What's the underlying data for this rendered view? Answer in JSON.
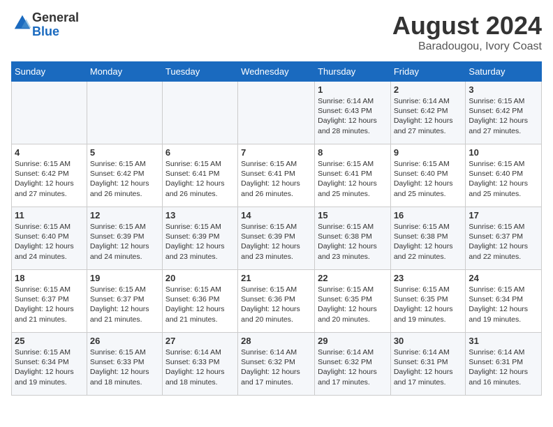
{
  "header": {
    "logo_line1": "General",
    "logo_line2": "Blue",
    "month": "August 2024",
    "location": "Baradougou, Ivory Coast"
  },
  "days_of_week": [
    "Sunday",
    "Monday",
    "Tuesday",
    "Wednesday",
    "Thursday",
    "Friday",
    "Saturday"
  ],
  "weeks": [
    [
      {
        "day": "",
        "info": ""
      },
      {
        "day": "",
        "info": ""
      },
      {
        "day": "",
        "info": ""
      },
      {
        "day": "",
        "info": ""
      },
      {
        "day": "1",
        "info": "Sunrise: 6:14 AM\nSunset: 6:43 PM\nDaylight: 12 hours\nand 28 minutes."
      },
      {
        "day": "2",
        "info": "Sunrise: 6:14 AM\nSunset: 6:42 PM\nDaylight: 12 hours\nand 27 minutes."
      },
      {
        "day": "3",
        "info": "Sunrise: 6:15 AM\nSunset: 6:42 PM\nDaylight: 12 hours\nand 27 minutes."
      }
    ],
    [
      {
        "day": "4",
        "info": "Sunrise: 6:15 AM\nSunset: 6:42 PM\nDaylight: 12 hours\nand 27 minutes."
      },
      {
        "day": "5",
        "info": "Sunrise: 6:15 AM\nSunset: 6:42 PM\nDaylight: 12 hours\nand 26 minutes."
      },
      {
        "day": "6",
        "info": "Sunrise: 6:15 AM\nSunset: 6:41 PM\nDaylight: 12 hours\nand 26 minutes."
      },
      {
        "day": "7",
        "info": "Sunrise: 6:15 AM\nSunset: 6:41 PM\nDaylight: 12 hours\nand 26 minutes."
      },
      {
        "day": "8",
        "info": "Sunrise: 6:15 AM\nSunset: 6:41 PM\nDaylight: 12 hours\nand 25 minutes."
      },
      {
        "day": "9",
        "info": "Sunrise: 6:15 AM\nSunset: 6:40 PM\nDaylight: 12 hours\nand 25 minutes."
      },
      {
        "day": "10",
        "info": "Sunrise: 6:15 AM\nSunset: 6:40 PM\nDaylight: 12 hours\nand 25 minutes."
      }
    ],
    [
      {
        "day": "11",
        "info": "Sunrise: 6:15 AM\nSunset: 6:40 PM\nDaylight: 12 hours\nand 24 minutes."
      },
      {
        "day": "12",
        "info": "Sunrise: 6:15 AM\nSunset: 6:39 PM\nDaylight: 12 hours\nand 24 minutes."
      },
      {
        "day": "13",
        "info": "Sunrise: 6:15 AM\nSunset: 6:39 PM\nDaylight: 12 hours\nand 23 minutes."
      },
      {
        "day": "14",
        "info": "Sunrise: 6:15 AM\nSunset: 6:39 PM\nDaylight: 12 hours\nand 23 minutes."
      },
      {
        "day": "15",
        "info": "Sunrise: 6:15 AM\nSunset: 6:38 PM\nDaylight: 12 hours\nand 23 minutes."
      },
      {
        "day": "16",
        "info": "Sunrise: 6:15 AM\nSunset: 6:38 PM\nDaylight: 12 hours\nand 22 minutes."
      },
      {
        "day": "17",
        "info": "Sunrise: 6:15 AM\nSunset: 6:37 PM\nDaylight: 12 hours\nand 22 minutes."
      }
    ],
    [
      {
        "day": "18",
        "info": "Sunrise: 6:15 AM\nSunset: 6:37 PM\nDaylight: 12 hours\nand 21 minutes."
      },
      {
        "day": "19",
        "info": "Sunrise: 6:15 AM\nSunset: 6:37 PM\nDaylight: 12 hours\nand 21 minutes."
      },
      {
        "day": "20",
        "info": "Sunrise: 6:15 AM\nSunset: 6:36 PM\nDaylight: 12 hours\nand 21 minutes."
      },
      {
        "day": "21",
        "info": "Sunrise: 6:15 AM\nSunset: 6:36 PM\nDaylight: 12 hours\nand 20 minutes."
      },
      {
        "day": "22",
        "info": "Sunrise: 6:15 AM\nSunset: 6:35 PM\nDaylight: 12 hours\nand 20 minutes."
      },
      {
        "day": "23",
        "info": "Sunrise: 6:15 AM\nSunset: 6:35 PM\nDaylight: 12 hours\nand 19 minutes."
      },
      {
        "day": "24",
        "info": "Sunrise: 6:15 AM\nSunset: 6:34 PM\nDaylight: 12 hours\nand 19 minutes."
      }
    ],
    [
      {
        "day": "25",
        "info": "Sunrise: 6:15 AM\nSunset: 6:34 PM\nDaylight: 12 hours\nand 19 minutes."
      },
      {
        "day": "26",
        "info": "Sunrise: 6:15 AM\nSunset: 6:33 PM\nDaylight: 12 hours\nand 18 minutes."
      },
      {
        "day": "27",
        "info": "Sunrise: 6:14 AM\nSunset: 6:33 PM\nDaylight: 12 hours\nand 18 minutes."
      },
      {
        "day": "28",
        "info": "Sunrise: 6:14 AM\nSunset: 6:32 PM\nDaylight: 12 hours\nand 17 minutes."
      },
      {
        "day": "29",
        "info": "Sunrise: 6:14 AM\nSunset: 6:32 PM\nDaylight: 12 hours\nand 17 minutes."
      },
      {
        "day": "30",
        "info": "Sunrise: 6:14 AM\nSunset: 6:31 PM\nDaylight: 12 hours\nand 17 minutes."
      },
      {
        "day": "31",
        "info": "Sunrise: 6:14 AM\nSunset: 6:31 PM\nDaylight: 12 hours\nand 16 minutes."
      }
    ]
  ]
}
